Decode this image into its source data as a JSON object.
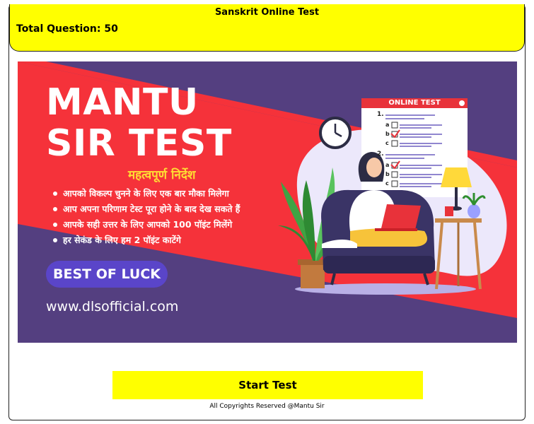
{
  "header": {
    "title": "Sanskrit Online Test",
    "question_count_label": "Total Question: 50"
  },
  "banner": {
    "title_line1": "MANTU",
    "title_line2": "SIR TEST",
    "subtitle": "महत्वपूर्ण निर्देश",
    "instructions": [
      "आपको विकल्प चुनने के लिए एक बार मौका मिलेगा",
      "आप अपना परिणाम टेस्ट पूरा होने के बाद देख सकते हैं",
      "आपके सही उत्तर के लिए आपको 100 पॉइंट मिलेंगे",
      "हर सेकंड के लिए हम 2 पॉइंट काटेंगे"
    ],
    "badge": "BEST OF LUCK",
    "website": "www.dlsofficial.com",
    "illustration_board_title": "ONLINE TEST",
    "board_q1": "1.",
    "board_q2": "2.",
    "options": [
      "a",
      "b",
      "c"
    ],
    "colors": {
      "purple": "#543f80",
      "red": "#f5323a",
      "yellow": "#ffff00",
      "badge": "#5a45c9"
    }
  },
  "footer": {
    "start_label": "Start Test",
    "copyright": "All Copyrights Reserved @Mantu Sir"
  }
}
